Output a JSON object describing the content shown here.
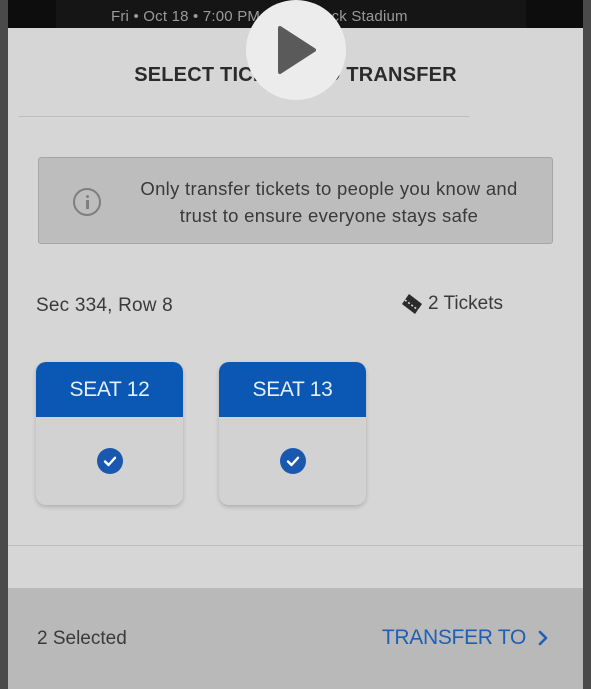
{
  "background": {
    "event_line": "Fri • Oct 18 • 7:00 PM • Hard Rock Stadium"
  },
  "sheet": {
    "title": "SELECT TICKETS TO TRANSFER",
    "notice": "Only transfer tickets to people you know and trust to ensure everyone stays safe",
    "section_row": "Sec  334, Row 8",
    "tickets_label": "2 Tickets",
    "seats": [
      {
        "label": "SEAT 12",
        "selected": true
      },
      {
        "label": "SEAT 13",
        "selected": true
      }
    ]
  },
  "footer": {
    "selected_text": "2 Selected",
    "transfer_label": "TRANSFER TO"
  },
  "colors": {
    "accent": "#0a58b3",
    "link": "#1f5fb6"
  },
  "icons": [
    "info-icon",
    "ticket-icon",
    "check-circle-icon",
    "chevron-right-icon",
    "play-icon"
  ]
}
